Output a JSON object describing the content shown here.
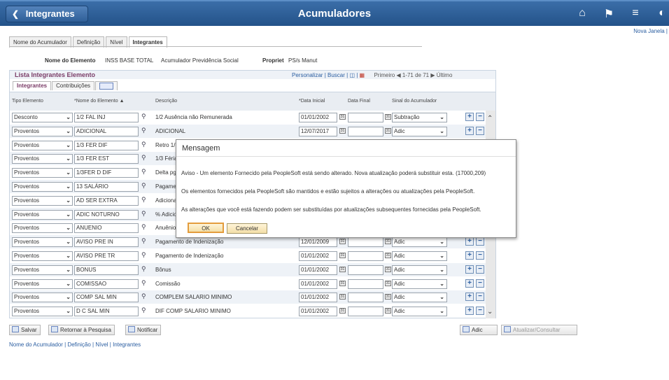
{
  "topbar": {
    "back_label": "Integrantes",
    "title": "Acumuladores"
  },
  "top_icons": [
    "home-icon",
    "flag-icon",
    "menu-icon",
    "navbar-icon"
  ],
  "nova_janela": "Nova Janela |",
  "tabs": [
    "Nome do Acumulador",
    "Definição",
    "Nível",
    "Integrantes"
  ],
  "header": {
    "nome_label": "Nome do Elemento",
    "nome_value": "INSS BASE TOTAL",
    "nome_desc": "Acumulador Previdência Social",
    "propriet_label": "Propriet",
    "propriet_value": "PS/s Manut"
  },
  "grid": {
    "title": "Lista Integrantes Elemento",
    "personalizar": "Personalizar",
    "buscar": "Buscar",
    "primeiro": "Primeiro",
    "range": "1-71 de 71",
    "ultimo": "Último",
    "subtabs": [
      "Integrantes",
      "Contribuições"
    ],
    "columns": [
      "Tipo Elemento",
      "*Nome do Elemento",
      "Descrição",
      "*Data Inicial",
      "Data Final",
      "Sinal do Acumulador"
    ],
    "rows": [
      {
        "tipo": "Desconto",
        "nome": "1/2 FAL INJ",
        "desc": "1/2 Ausência não Remunerada",
        "data": "01/01/2002",
        "sinal": "Subtração"
      },
      {
        "tipo": "Proventos",
        "nome": "ADICIONAL",
        "desc": "ADICIONAL",
        "data": "12/07/2017",
        "sinal": "Adic"
      },
      {
        "tipo": "Proventos",
        "nome": "1/3 FER DIF",
        "desc": "Retro 1/",
        "data": "",
        "sinal": ""
      },
      {
        "tipo": "Proventos",
        "nome": "1/3 FER EST",
        "desc": "1/3 Féria",
        "data": "",
        "sinal": ""
      },
      {
        "tipo": "Proventos",
        "nome": "1/3FER D DIF",
        "desc": "Delta pg",
        "data": "",
        "sinal": ""
      },
      {
        "tipo": "Proventos",
        "nome": "13 SALÁRIO",
        "desc": "Pagame",
        "data": "",
        "sinal": ""
      },
      {
        "tipo": "Proventos",
        "nome": "AD SER EXTRA",
        "desc": "Adiciona",
        "data": "",
        "sinal": ""
      },
      {
        "tipo": "Proventos",
        "nome": "ADIC NOTURNO",
        "desc": "% Adicio",
        "data": "",
        "sinal": ""
      },
      {
        "tipo": "Proventos",
        "nome": "ANUENIO",
        "desc": "Anuênio",
        "data": "",
        "sinal": ""
      },
      {
        "tipo": "Proventos",
        "nome": "AVISO PRE IN",
        "desc": "Pagamento de Indenização",
        "data": "12/01/2009",
        "sinal": "Adic"
      },
      {
        "tipo": "Proventos",
        "nome": "AVISO PRE TR",
        "desc": "Pagamento de Indenização",
        "data": "01/01/2002",
        "sinal": "Adic"
      },
      {
        "tipo": "Proventos",
        "nome": "BONUS",
        "desc": "Bônus",
        "data": "01/01/2002",
        "sinal": "Adic"
      },
      {
        "tipo": "Proventos",
        "nome": "COMISSAO",
        "desc": "Comissão",
        "data": "01/01/2002",
        "sinal": "Adic"
      },
      {
        "tipo": "Proventos",
        "nome": "COMP SAL MIN",
        "desc": "COMPLEM SALARIO MINIMO",
        "data": "01/01/2002",
        "sinal": "Adic"
      },
      {
        "tipo": "Proventos",
        "nome": "D C SAL MIN",
        "desc": "DIF COMP SALARIO MINIMO",
        "data": "01/01/2002",
        "sinal": "Adic"
      }
    ]
  },
  "dialog": {
    "title": "Mensagem",
    "msg1": "Aviso - Um elemento Fornecido pela PeopleSoft está sendo alterado. Nova atualização poderá substituir esta. (17000,209)",
    "msg2": "Os elementos fornecidos pela PeopleSoft são mantidos e estão sujeitos a alterações ou atualizações pela PeopleSoft.",
    "msg3": "As alterações que você está fazendo podem ser substituídas por atualizações subsequentes fornecidas pela PeopleSoft.",
    "ok": "OK",
    "cancel": "Cancelar"
  },
  "buttons": {
    "salvar": "Salvar",
    "retornar": "Retornar à Pesquisa",
    "notificar": "Notificar",
    "adic": "Adic",
    "atualizar": "Atualizar/Consultar"
  },
  "footer_links": "Nome do Acumulador | Definição | Nível | Integrantes"
}
